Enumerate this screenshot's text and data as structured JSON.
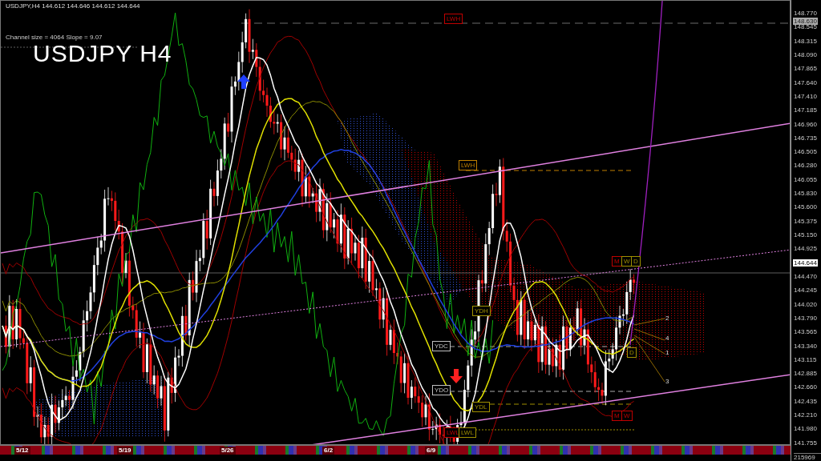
{
  "header": {
    "symbol_line": "USDJPY,H4  144.612 144.646 144.612 144.644",
    "channel_info": "Channel size = 4064 Slope = 9.07",
    "big_title": "USDJPY H4"
  },
  "price_axis": {
    "labels": [
      "148.770",
      "148.545",
      "148.315",
      "148.090",
      "147.865",
      "147.640",
      "147.410",
      "147.185",
      "146.960",
      "146.735",
      "146.505",
      "146.280",
      "146.055",
      "145.830",
      "145.600",
      "145.375",
      "145.150",
      "144.925",
      "144.470",
      "144.245",
      "144.020",
      "143.790",
      "143.565",
      "143.340",
      "143.115",
      "142.885",
      "142.660",
      "142.435",
      "142.210",
      "141.980",
      "141.755"
    ],
    "highlighted_label": "148.630",
    "current_price": "144.644",
    "volume": "215969"
  },
  "time_axis": {
    "labels": [
      "5/12",
      "5/19",
      "5/26",
      "6/2",
      "6/9"
    ]
  },
  "level_tags": [
    {
      "text": "LWH",
      "color": "#c00000"
    },
    {
      "text": "LWH",
      "color": "#c08000"
    },
    {
      "text": "M",
      "color": "#c00000"
    },
    {
      "text": "W",
      "color": "#a09000"
    },
    {
      "text": "D",
      "color": "#a09000"
    },
    {
      "text": "YDH",
      "color": "#a09000"
    },
    {
      "text": "YDC",
      "color": "#c0c0c0"
    },
    {
      "text": "YDO",
      "color": "#c0c0c0"
    },
    {
      "text": "YDL",
      "color": "#a09000"
    },
    {
      "text": "D",
      "color": "#a09000"
    },
    {
      "text": "LWL",
      "color": "#c00000"
    },
    {
      "text": "LWL",
      "color": "#a09000"
    },
    {
      "text": "M",
      "color": "#c00000"
    },
    {
      "text": "W",
      "color": "#c00000"
    }
  ],
  "wave_labels": [
    "2",
    "4",
    "1",
    "3"
  ]
}
